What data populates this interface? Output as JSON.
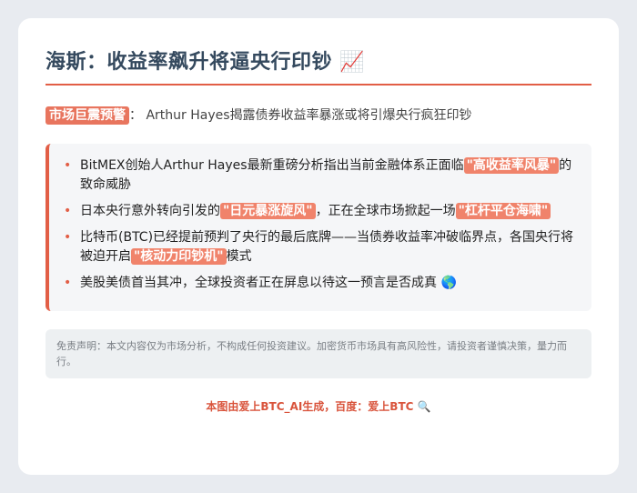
{
  "title": {
    "text": "海斯：收益率飙升将逼央行印钞",
    "icon": "📈"
  },
  "warning": {
    "badge": "市场巨震预警",
    "colon": "：",
    "text": "Arthur Hayes揭露债券收益率暴涨或将引爆央行疯狂印钞"
  },
  "points": [
    {
      "pre": "BitMEX创始人Arthur Hayes最新重磅分析指出当前金融体系正面临",
      "hl": "\"高收益率风暴\"",
      "post": "的致命威胁"
    },
    {
      "pre": "日本央行意外转向引发的",
      "hl": "\"日元暴涨旋风\"",
      "mid": "，正在全球市场掀起一场",
      "hl2": "\"杠杆平仓海啸\""
    },
    {
      "pre": "比特币(BTC)已经提前预判了央行的最后底牌——当债券收益率冲破临界点，各国央行将被迫开启",
      "hl": "\"核动力印钞机\"",
      "post": "模式"
    },
    {
      "pre": "美股美债首当其冲，全球投资者正在屏息以待这一预言是否成真",
      "icon": "🌎"
    }
  ],
  "disclaimer": "免责声明：本文内容仅为市场分析，不构成任何投资建议。加密货币市场具有高风险性，请投资者谨慎决策，量力而行。",
  "footer": {
    "text": "本图由爱上BTC_AI生成，百度：爱上BTC",
    "icon": "🔍"
  },
  "colors": {
    "accent": "#e25e46",
    "highlight": "#f0836b",
    "title": "#34495e"
  }
}
